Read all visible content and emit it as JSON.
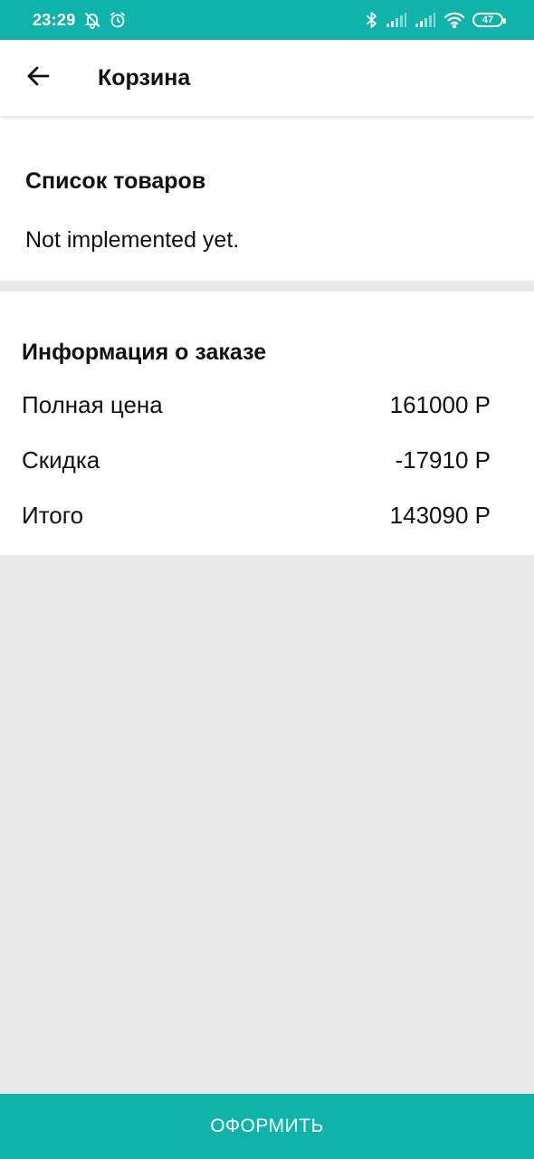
{
  "status_bar": {
    "time": "23:29",
    "battery_level": "47",
    "icons": [
      "bell-off-icon",
      "alarm-icon",
      "bluetooth-icon",
      "signal-icon",
      "signal-icon",
      "wifi-icon",
      "battery-icon"
    ],
    "background": "#0fb3a9"
  },
  "app_bar": {
    "title": "Корзина",
    "back_icon": "arrow-left-icon"
  },
  "products": {
    "title": "Список товаров",
    "placeholder_text": "Not implemented yet."
  },
  "order_info": {
    "title": "Информация о заказе",
    "rows": [
      {
        "label": "Полная цена",
        "value": "161000 Р"
      },
      {
        "label": "Скидка",
        "value": "-17910 Р"
      },
      {
        "label": "Итого",
        "value": "143090 Р"
      }
    ]
  },
  "checkout": {
    "label": "ОФОРМИТЬ"
  },
  "colors": {
    "accent": "#0fb3a9",
    "background": "#e9e9e9",
    "surface": "#ffffff"
  }
}
